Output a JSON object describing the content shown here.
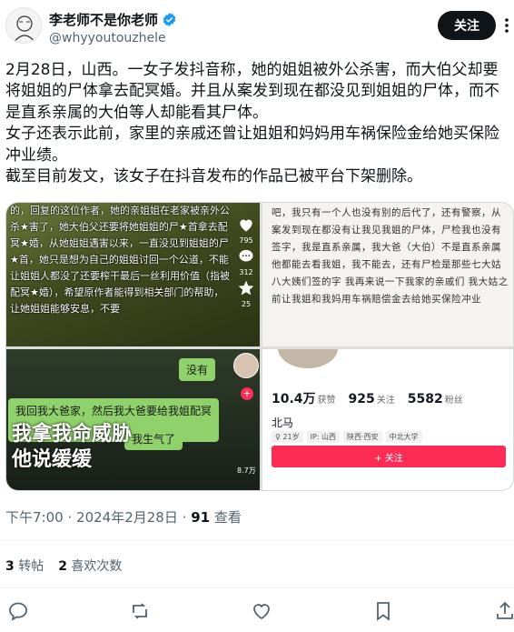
{
  "author": {
    "display_name": "李老师不是你老师",
    "handle": "@whyyoutouzhele"
  },
  "follow_label": "关注",
  "post": {
    "paragraphs": [
      "2月28日，山西。一女子发抖音称，她的姐姐被外公杀害，而大伯父却要将姐姐的尸体拿去配冥婚。并且从案发到现在都没见到姐姐的尸体，而不是直系亲属的大伯等人却能看其尸体。",
      "女子还表示此前，家里的亲戚还曾让姐姐和妈妈用车祸保险金给她买保险冲业绩。",
      "截至目前发文，该女子在抖音发布的作品已被平台下架删除。"
    ]
  },
  "media": {
    "tile1": {
      "text": "的，回复的这位作者，她的亲姐姐在老家被亲外公杀★害了，她大伯父还要将她姐姐的尸★首拿去配冥★婚，从她姐姐遇害以来，一直没见到姐姐的尸★首，她只是想为自己的姐姐讨回一个公道，不能让姐姐人都没了还要榨干最后一丝利用价值（指被配冥★婚），希望原作者能得到相关部门的帮助，让她姐姐能够安息，不要",
      "likes": "795",
      "comments": "312",
      "favorites": "25"
    },
    "tile2": {
      "text": "吧，我只有一个人也没有别的后代了，还有警察，从案发到现在都没有让我见我姐的尸体，尸检我也没有签字，我是直系亲属，我大爸（大伯）不是直系亲属他都能去看我姐，我不能去，还有尸检是那些七大姑八大姨们签的字 我再来说一下我家的亲戚们 我大姑之前让我姐和我妈用车祸赔偿金去给她买保险冲业"
    },
    "tile3": {
      "bubble1": "没有",
      "bubble2": "我回我大爸家，然后我大爸要给我姐配冥婚",
      "bubble3": "我生气了",
      "caption_line1": "我拿我命威胁",
      "caption_line2": "他说缓缓",
      "count": "8.7万"
    },
    "tile4": {
      "likes_value": "10.4万",
      "likes_label": "获赞",
      "following_value": "925",
      "following_label": "关注",
      "followers_value": "5582",
      "followers_label": "粉丝",
      "name": "北马",
      "tags": [
        "♀ 21岁",
        "IP: 山西",
        "陕西·西安",
        "中北大学"
      ],
      "follow_label": "+ 关注"
    }
  },
  "meta": {
    "time": "下午7:00",
    "date": "2024年2月28日",
    "separator": "·",
    "views_value": "91",
    "views_label": "查看"
  },
  "stats": {
    "reposts_value": "3",
    "reposts_label": "转帖",
    "likes_value": "2",
    "likes_label": "喜欢次数"
  },
  "icons": {
    "verified": "verified-badge-icon",
    "more": "more-icon",
    "reply": "reply-icon",
    "repost": "repost-icon",
    "like": "heart-icon",
    "bookmark": "bookmark-icon",
    "share": "share-icon"
  },
  "colors": {
    "verified_blue": "#1d9bf0",
    "text_primary": "#0f1419",
    "text_secondary": "#536471",
    "douyin_red": "#fe2c55"
  }
}
